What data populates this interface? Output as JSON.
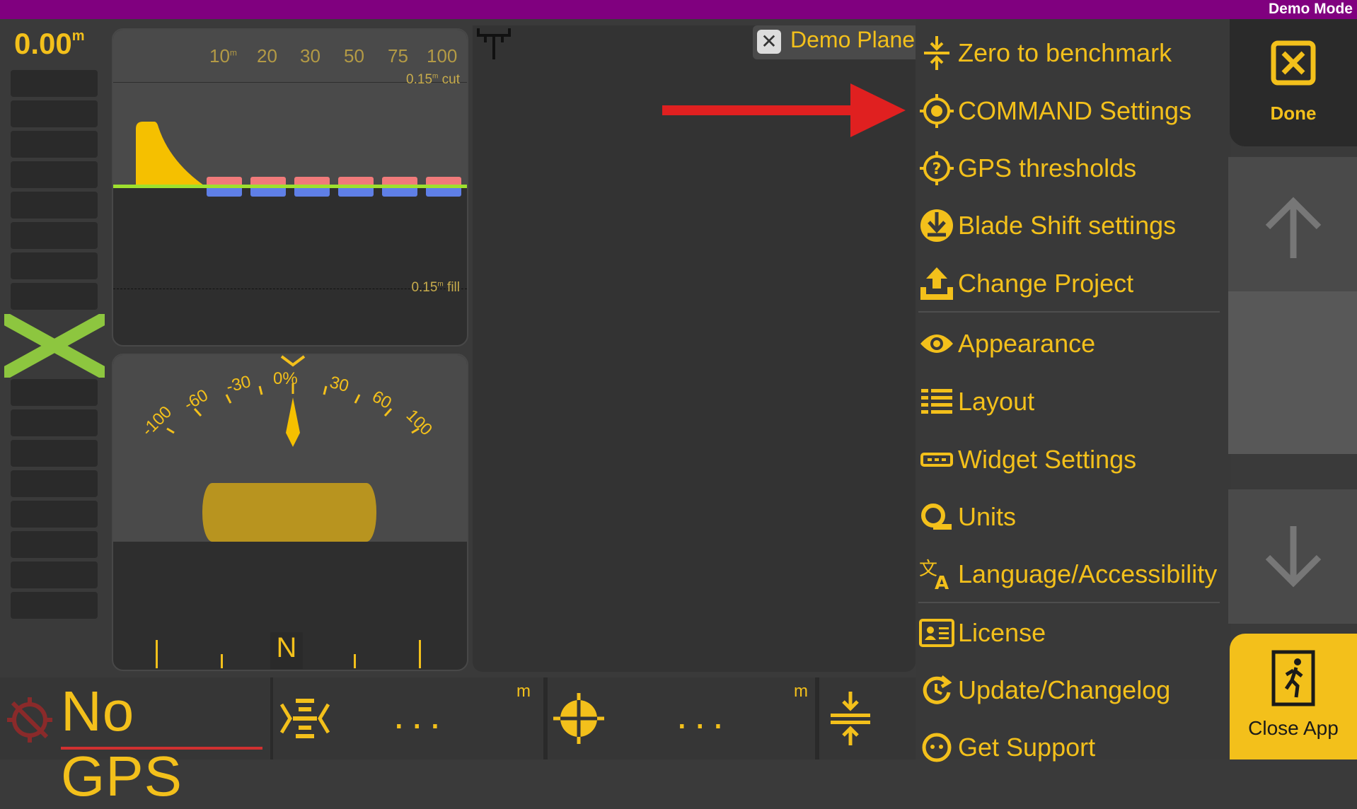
{
  "header": {
    "mode": "Demo Mode"
  },
  "elevation": {
    "value": "0.00",
    "unit": "m"
  },
  "cutfill": {
    "scale": [
      "10",
      "20",
      "30",
      "50",
      "75",
      "100"
    ],
    "scale_unit": "m",
    "cut_value": "0.15",
    "cut_unit": "m",
    "cut_word": " cut",
    "fill_value": "0.15",
    "fill_unit": "m",
    "fill_word": " fill"
  },
  "slope": {
    "labels": [
      "-100",
      "-60",
      "-30",
      "0%",
      "30",
      "60",
      "100"
    ],
    "compass_heading": "N"
  },
  "map": {
    "plane_label": "Demo Plane"
  },
  "menu": {
    "items": [
      {
        "label": "Zero to benchmark",
        "icon": "benchmark-icon"
      },
      {
        "label": "COMMAND Settings",
        "icon": "target-gear-icon"
      },
      {
        "label": "GPS thresholds",
        "icon": "question-target-icon"
      },
      {
        "label": "Blade Shift settings",
        "icon": "download-circle-icon"
      },
      {
        "label": "Change Project",
        "icon": "upload-tray-icon"
      },
      {
        "label": "Appearance",
        "icon": "eye-icon"
      },
      {
        "label": "Layout",
        "icon": "layout-list-icon"
      },
      {
        "label": "Widget Settings",
        "icon": "widget-bar-icon"
      },
      {
        "label": "Units",
        "icon": "tape-measure-icon"
      },
      {
        "label": "Language/Accessibility",
        "icon": "translate-icon"
      },
      {
        "label": "License",
        "icon": "id-card-icon"
      },
      {
        "label": "Update/Changelog",
        "icon": "refresh-icon"
      },
      {
        "label": "Get Support",
        "icon": "support-face-icon"
      }
    ]
  },
  "right": {
    "done_label": "Done",
    "close_label": "Close App"
  },
  "bottom": {
    "gps_status": "No GPS",
    "field1_unit": "m",
    "field1_value": "...",
    "field2_unit": "m",
    "field2_value": "..."
  },
  "colors": {
    "accent": "#f3c01b",
    "topbar": "#80007f",
    "design_line": "#9ee02e",
    "annotation_arrow": "#e02020"
  }
}
